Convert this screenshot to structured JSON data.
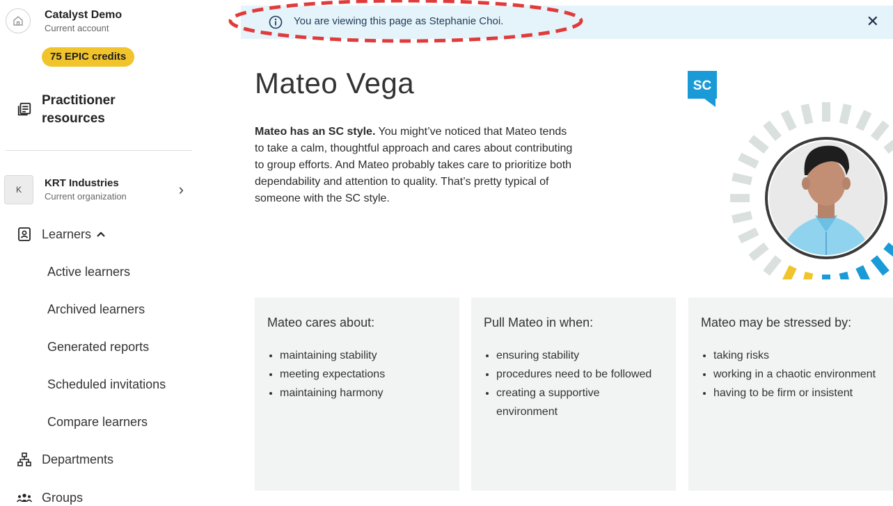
{
  "account": {
    "name": "Catalyst Demo",
    "subtitle": "Current account",
    "credits": "75 EPIC credits"
  },
  "sidebar": {
    "resources_label": "Practitioner resources",
    "org": {
      "initial": "K",
      "name": "KRT Industries",
      "subtitle": "Current organization"
    },
    "learners_label": "Learners",
    "learner_items": [
      "Active learners",
      "Archived learners",
      "Generated reports",
      "Scheduled invitations",
      "Compare learners"
    ],
    "departments_label": "Departments",
    "groups_label": "Groups"
  },
  "banner": {
    "text": "You are viewing this page as Stephanie Choi."
  },
  "profile": {
    "name": "Mateo Vega",
    "style_badge": "SC",
    "intro_bold": "Mateo has an SC style.",
    "intro_rest": " You might’ve noticed that Mateo tends to take a calm, thoughtful approach and cares about contributing to group efforts. And Mateo probably takes care to prioritize both dependability and attention to quality. That’s pretty typical of someone with the SC style."
  },
  "cards": [
    {
      "title": "Mateo cares about:",
      "items": [
        "maintaining stability",
        "meeting expectations",
        "maintaining harmony"
      ]
    },
    {
      "title": "Pull Mateo in when:",
      "items": [
        "ensuring stability",
        "procedures need to be followed",
        "creating a supportive environment"
      ]
    },
    {
      "title": "Mateo may be stressed by:",
      "items": [
        "taking risks",
        "working in a chaotic environment",
        "having to be firm or insistent"
      ]
    }
  ],
  "colors": {
    "credits": "#f2c42b",
    "banner_bg": "#e5f3fa",
    "badge": "#1a9ad6",
    "highlight_oval": "#e03a3a",
    "card_bg": "#f2f3f3"
  }
}
